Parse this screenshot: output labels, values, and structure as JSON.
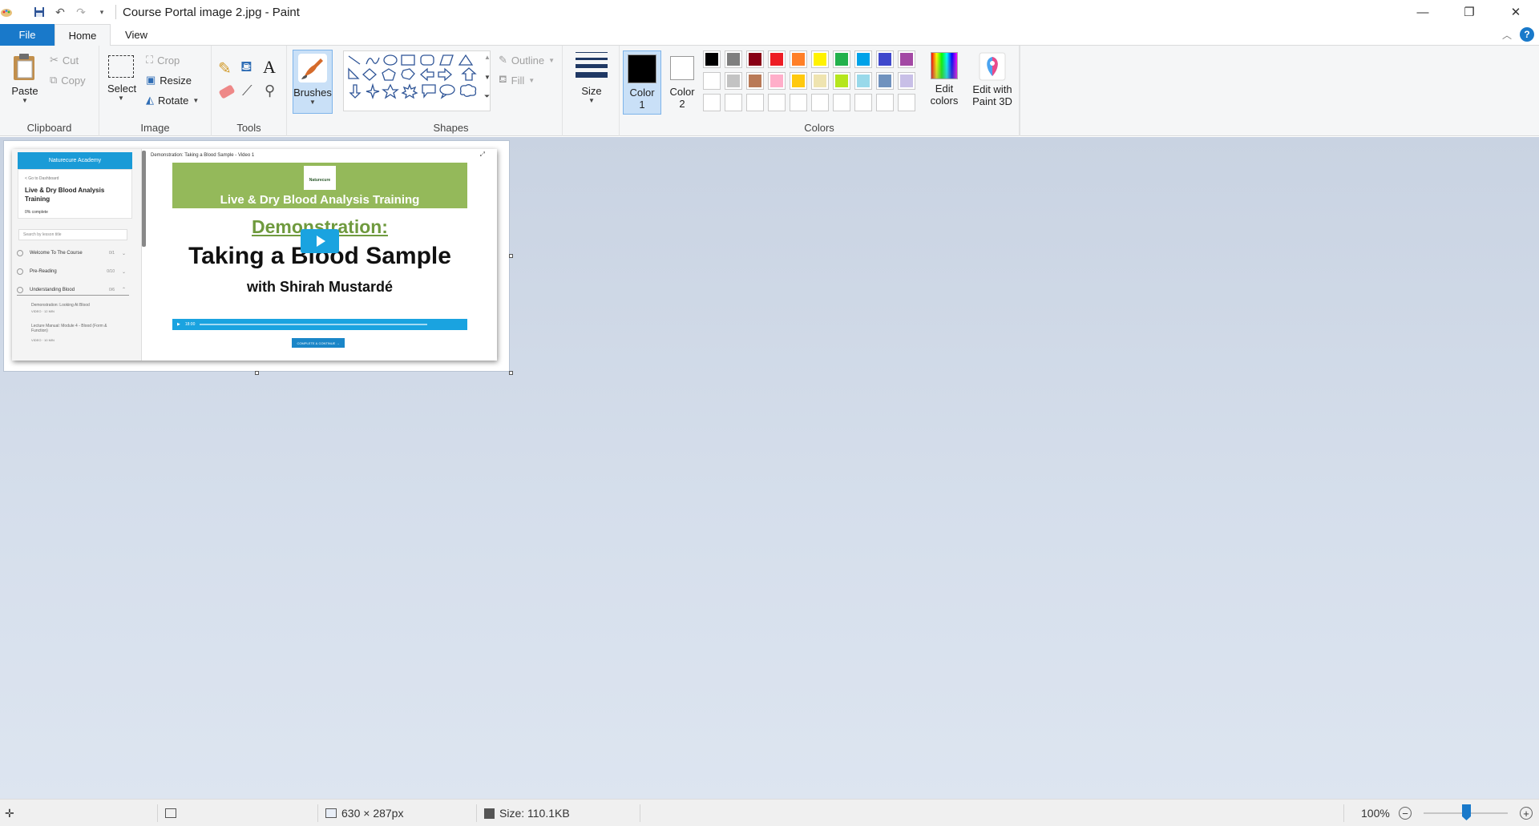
{
  "window": {
    "title": "Course Portal image 2.jpg - Paint",
    "controls": {
      "minimize": "—",
      "maximize": "❐",
      "close": "✕"
    }
  },
  "tabs": {
    "file": "File",
    "home": "Home",
    "view": "View"
  },
  "ribbon": {
    "clipboard": {
      "label": "Clipboard",
      "paste": "Paste",
      "cut": "Cut",
      "copy": "Copy"
    },
    "image": {
      "label": "Image",
      "select": "Select",
      "crop": "Crop",
      "resize": "Resize",
      "rotate": "Rotate"
    },
    "tools": {
      "label": "Tools"
    },
    "brushes": {
      "label": "Brushes"
    },
    "shapes": {
      "label": "Shapes",
      "outline": "Outline",
      "fill": "Fill"
    },
    "size": {
      "label": "Size"
    },
    "colors": {
      "label": "Colors",
      "color1_line1": "Color",
      "color1_line2": "1",
      "color2_line1": "Color",
      "color2_line2": "2",
      "edit_colors_line1": "Edit",
      "edit_colors_line2": "colors",
      "color1_value": "#000000",
      "color2_value": "#ffffff",
      "palette_row1": [
        "#000000",
        "#7f7f7f",
        "#880015",
        "#ed1c24",
        "#ff7f27",
        "#fff200",
        "#22b14c",
        "#00a2e8",
        "#3f48cc",
        "#a349a4"
      ],
      "palette_row2": [
        "#ffffff",
        "#c3c3c3",
        "#b97a57",
        "#ffaec9",
        "#ffc90e",
        "#efe4b0",
        "#b5e61d",
        "#99d9ea",
        "#7092be",
        "#c8bfe7"
      ]
    },
    "paint3d": {
      "line1": "Edit with",
      "line2": "Paint 3D"
    }
  },
  "canvas_image": {
    "brand": "Naturecure Academy",
    "back_link": "< Go to Dashboard",
    "course_title": "Live & Dry Blood Analysis Training",
    "progress": "0% complete",
    "search_placeholder": "Search by lesson title",
    "sections": [
      {
        "label": "Welcome To The Course",
        "count": "0/1"
      },
      {
        "label": "Pre-Reading",
        "count": "0/10"
      },
      {
        "label": "Understanding Blood",
        "count": "0/6"
      }
    ],
    "lessons": [
      {
        "label": "Demonstration: Looking At Blood",
        "meta": "VIDEO · 12 MIN"
      },
      {
        "label": "Lecture Manual: Module 4 - Blood (Form & Function)",
        "meta": "VIDEO · 10 MIN"
      }
    ],
    "lesson_header": "Demonstration: Taking a Blood Sample - Video 1",
    "logo_text": "Naturecure",
    "banner": "Live & Dry Blood Analysis Training",
    "demo_label": "Demonstration:",
    "heading": "Taking a Blood Sample",
    "presenter": "with Shirah Mustardé",
    "video_time": "18:00",
    "complete_button": "COMPLETE & CONTINUE →"
  },
  "status": {
    "dimensions": "630 × 287px",
    "size": "Size: 110.1KB",
    "zoom": "100%"
  }
}
